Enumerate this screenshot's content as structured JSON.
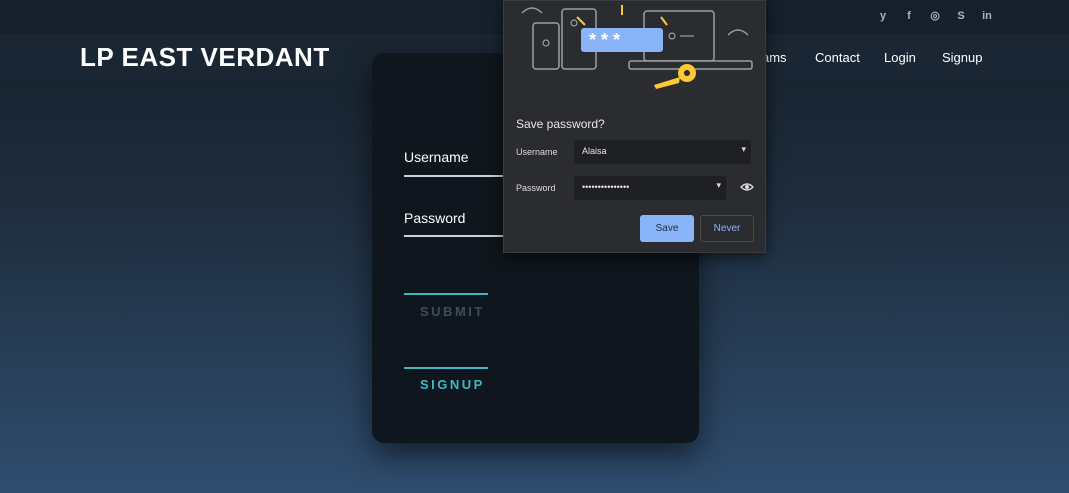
{
  "site": {
    "brand": "LP EAST VERDANT",
    "social_icons": [
      "twitter-icon",
      "facebook-icon",
      "instagram-icon",
      "skype-icon",
      "linkedin-icon"
    ],
    "social_glyphs": [
      "y",
      "f",
      "◎",
      "S",
      "in"
    ],
    "nav": [
      {
        "label": "ams"
      },
      {
        "label": "Contact"
      },
      {
        "label": "Login"
      },
      {
        "label": "Signup"
      }
    ]
  },
  "login_form": {
    "username_label": "Username",
    "password_label": "Password",
    "submit_label": "SUBMIT",
    "signup_label": "SIGNUP"
  },
  "password_popup": {
    "title": "Save password?",
    "username_label": "Username",
    "username_value": "Alaisa",
    "password_label": "Password",
    "password_value": "•••••••••••••••",
    "illustration_text": "* * *",
    "save_label": "Save",
    "never_label": "Never",
    "accent_color": "#8ab4f8"
  }
}
